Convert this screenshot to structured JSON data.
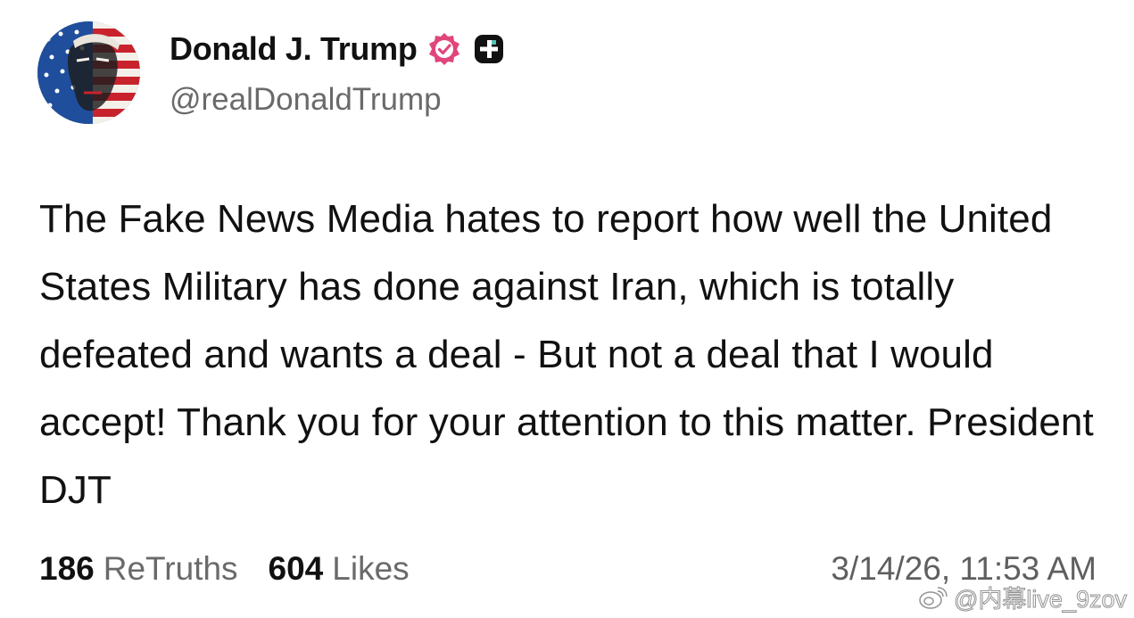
{
  "author": {
    "display_name": "Donald J. Trump",
    "handle": "@realDonaldTrump",
    "avatar_icon": "flag-portrait-avatar",
    "verified_icon": "verified-badge-icon",
    "plus_icon": "plus-badge-icon",
    "verified_color": "#e0457b"
  },
  "post": {
    "text": "The Fake News Media hates to report how well the United States Military has done against Iran, which is totally defeated and wants a deal - But not a deal that I would accept! Thank you for your attention to this matter. President DJT"
  },
  "stats": {
    "retruths_count": "186",
    "retruths_label": "ReTruths",
    "likes_count": "604",
    "likes_label": "Likes"
  },
  "timestamp": "3/14/26, 11:53 AM",
  "watermark": {
    "icon": "weibo-icon",
    "text": "@内幕live_9zov"
  }
}
